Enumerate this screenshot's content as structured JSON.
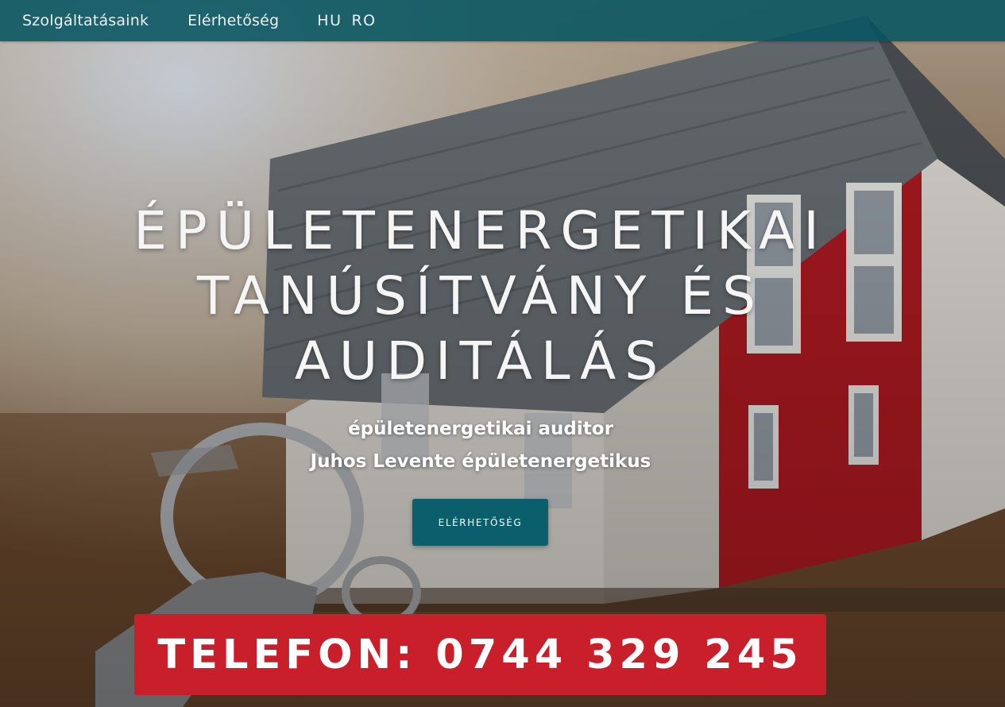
{
  "nav": {
    "services": "Szolgáltatásaink",
    "contact": "Elérhetőség",
    "languages": [
      "HU",
      "RO"
    ]
  },
  "hero": {
    "headline_lines": [
      "ÉPÜLETENERGETIKAI",
      "TANÚSÍTVÁNY ÉS",
      "AUDITÁLÁS"
    ],
    "subtitle_lines": [
      "épületenergetikai auditor",
      "Juhos Levente épületenergetikus"
    ],
    "cta_label": "ELÉRHETŐSÉG",
    "phone_banner": "TELEFON: 0744 329 245"
  },
  "colors": {
    "navbar": "#065460",
    "cta": "#0b5e6c",
    "phone_banner": "#c81f2a"
  }
}
